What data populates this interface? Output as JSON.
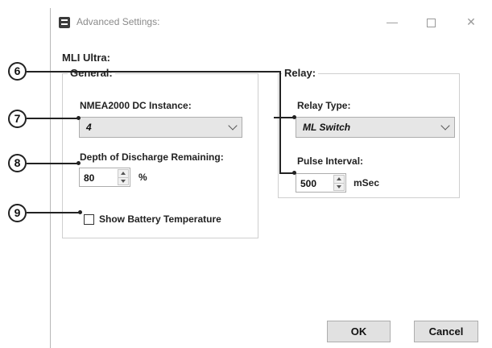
{
  "window": {
    "title": "Advanced Settings:",
    "controls": {
      "minimize": "—",
      "close": "✕"
    }
  },
  "product_label": "MLI Ultra:",
  "general": {
    "title": "General:",
    "nmea_label": "NMEA2000 DC Instance:",
    "nmea_value": "4",
    "dod_label": "Depth of Discharge Remaining:",
    "dod_value": "80",
    "dod_unit": "%",
    "show_temp_label": "Show Battery Temperature",
    "show_temp_checked": false
  },
  "relay": {
    "title": "Relay:",
    "type_label": "Relay Type:",
    "type_value": "ML Switch",
    "pulse_label": "Pulse Interval:",
    "pulse_value": "500",
    "pulse_unit": "mSec"
  },
  "buttons": {
    "ok": "OK",
    "cancel": "Cancel"
  },
  "callouts": [
    "6",
    "7",
    "8",
    "9"
  ],
  "icons": [
    "app-icon",
    "chevron-down-icon",
    "spin-up-icon",
    "spin-down-icon",
    "checkbox-icon"
  ]
}
